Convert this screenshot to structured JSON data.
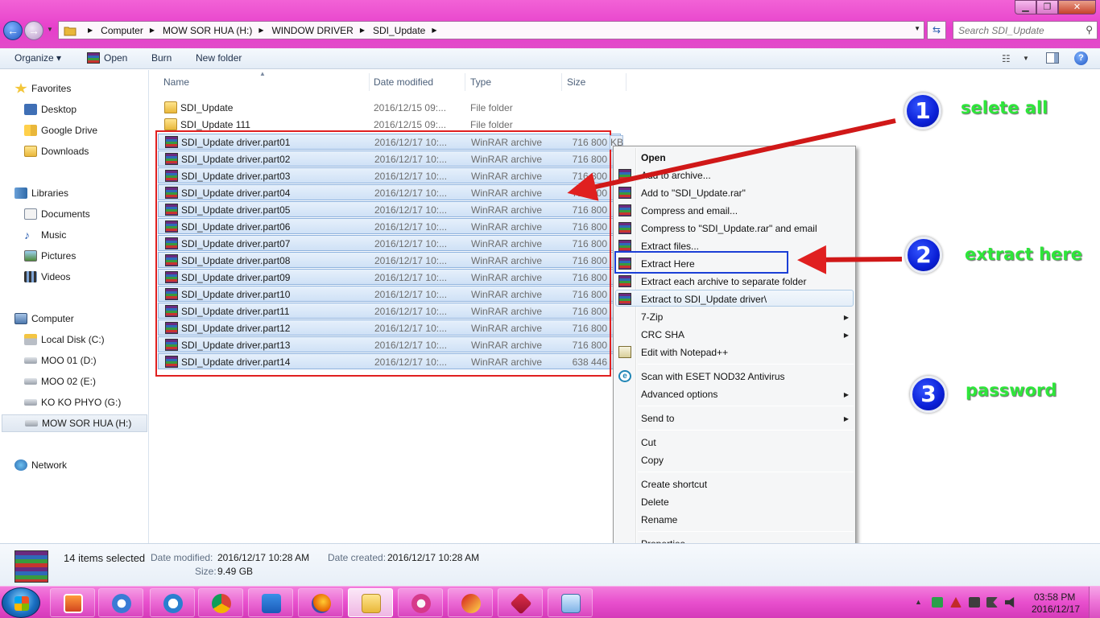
{
  "window": {
    "breadcrumb": [
      "Computer",
      "MOW SOR HUA (H:)",
      "WINDOW DRIVER",
      "SDI_Update"
    ],
    "search_placeholder": "Search SDI_Update",
    "min_label": "▁",
    "max_label": "❐",
    "close_label": "✕"
  },
  "toolbar": {
    "organize": "Organize ▾",
    "open": "Open",
    "burn": "Burn",
    "new_folder": "New folder"
  },
  "nav": {
    "favorites": "Favorites",
    "desktop": "Desktop",
    "google_drive": "Google Drive",
    "downloads": "Downloads",
    "libraries": "Libraries",
    "documents": "Documents",
    "music": "Music",
    "pictures": "Pictures",
    "videos": "Videos",
    "computer": "Computer",
    "drives": [
      "Local Disk (C:)",
      "MOO 01 (D:)",
      "MOO 02 (E:)",
      "KO  KO PHYO (G:)",
      "MOW SOR HUA (H:)"
    ],
    "network": "Network"
  },
  "columns": {
    "name": "Name",
    "date": "Date modified",
    "type": "Type",
    "size": "Size"
  },
  "files": [
    {
      "name": "SDI_Update",
      "date": "2016/12/15 09:...",
      "type": "File folder",
      "size": "",
      "kind": "folder"
    },
    {
      "name": "SDI_Update 111",
      "date": "2016/12/15 09:...",
      "type": "File folder",
      "size": "",
      "kind": "folder"
    },
    {
      "name": "SDI_Update driver.part01",
      "date": "2016/12/17 10:...",
      "type": "WinRAR archive",
      "size": "716 800",
      "kind": "rar"
    },
    {
      "name": "SDI_Update driver.part02",
      "date": "2016/12/17 10:...",
      "type": "WinRAR archive",
      "size": "716 800",
      "kind": "rar"
    },
    {
      "name": "SDI_Update driver.part03",
      "date": "2016/12/17 10:...",
      "type": "WinRAR archive",
      "size": "716 800",
      "kind": "rar"
    },
    {
      "name": "SDI_Update driver.part04",
      "date": "2016/12/17 10:...",
      "type": "WinRAR archive",
      "size": "716 800",
      "kind": "rar"
    },
    {
      "name": "SDI_Update driver.part05",
      "date": "2016/12/17 10:...",
      "type": "WinRAR archive",
      "size": "716 800",
      "kind": "rar"
    },
    {
      "name": "SDI_Update driver.part06",
      "date": "2016/12/17 10:...",
      "type": "WinRAR archive",
      "size": "716 800",
      "kind": "rar"
    },
    {
      "name": "SDI_Update driver.part07",
      "date": "2016/12/17 10:...",
      "type": "WinRAR archive",
      "size": "716 800",
      "kind": "rar"
    },
    {
      "name": "SDI_Update driver.part08",
      "date": "2016/12/17 10:...",
      "type": "WinRAR archive",
      "size": "716 800",
      "kind": "rar"
    },
    {
      "name": "SDI_Update driver.part09",
      "date": "2016/12/17 10:...",
      "type": "WinRAR archive",
      "size": "716 800",
      "kind": "rar"
    },
    {
      "name": "SDI_Update driver.part10",
      "date": "2016/12/17 10:...",
      "type": "WinRAR archive",
      "size": "716 800",
      "kind": "rar"
    },
    {
      "name": "SDI_Update driver.part11",
      "date": "2016/12/17 10:...",
      "type": "WinRAR archive",
      "size": "716 800",
      "kind": "rar"
    },
    {
      "name": "SDI_Update driver.part12",
      "date": "2016/12/17 10:...",
      "type": "WinRAR archive",
      "size": "716 800",
      "kind": "rar"
    },
    {
      "name": "SDI_Update driver.part13",
      "date": "2016/12/17 10:...",
      "type": "WinRAR archive",
      "size": "716 800",
      "kind": "rar"
    },
    {
      "name": "SDI_Update driver.part14",
      "date": "2016/12/17 10:...",
      "type": "WinRAR archive",
      "size": "638 446",
      "kind": "rar"
    }
  ],
  "size_stub": "KB",
  "menu": {
    "open": "Open",
    "add_to_archive": "Add to archive...",
    "add_to_rar": "Add to \"SDI_Update.rar\"",
    "compress_email": "Compress and email...",
    "compress_rar_email": "Compress to \"SDI_Update.rar\" and email",
    "extract_files": "Extract files...",
    "extract_here": "Extract Here",
    "extract_each": "Extract each archive to separate folder",
    "extract_to": "Extract to SDI_Update driver\\",
    "seven_zip": "7-Zip",
    "crc_sha": "CRC SHA",
    "edit_notepad": "Edit with Notepad++",
    "scan_eset": "Scan with ESET NOD32 Antivirus",
    "advanced": "Advanced options",
    "send_to": "Send to",
    "cut": "Cut",
    "copy": "Copy",
    "create_shortcut": "Create shortcut",
    "delete": "Delete",
    "rename": "Rename",
    "properties": "Properties"
  },
  "annotations": {
    "step1_num": "1",
    "step1_text": "selete all",
    "step2_num": "2",
    "step2_text": "extract here",
    "step3_num": "3",
    "step3_text": "password"
  },
  "details": {
    "selected": "14 items selected",
    "date_modified_label": "Date modified:",
    "date_modified": "2016/12/17 10:28 AM",
    "date_created_label": "Date created:",
    "date_created": "2016/12/17 10:28 AM",
    "size_label": "Size:",
    "size": "9.49 GB"
  },
  "taskbar": {
    "time": "03:58 PM",
    "date": "2016/12/17"
  },
  "colors": {
    "chrome_pink": "#e63fcb",
    "annotation_red": "#e02020",
    "annotation_blue": "#1b3fd6",
    "annotation_green": "#2ee63a"
  }
}
